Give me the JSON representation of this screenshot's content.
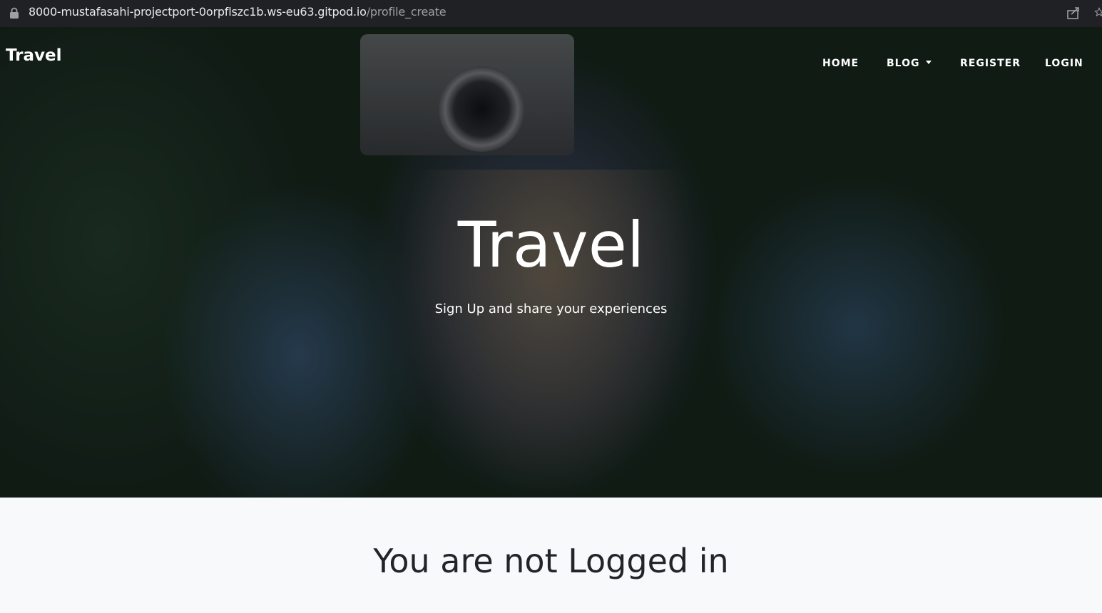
{
  "browser": {
    "url_host": "8000-mustafasahi-projectport-0orpflszc1b.ws-eu63.gitpod.io",
    "url_path": "/profile_create",
    "icons": [
      "lock-icon",
      "share-icon",
      "star-icon"
    ]
  },
  "navbar": {
    "brand": "Travel",
    "items": [
      {
        "label": "HOME"
      },
      {
        "label": "BLOG",
        "dropdown": true
      },
      {
        "label": "REGISTER"
      },
      {
        "label": "LOGIN"
      }
    ]
  },
  "hero": {
    "title": "Travel",
    "subtitle": "Sign Up and share your experiences"
  },
  "main": {
    "message": "You are not Logged in"
  },
  "colors": {
    "browser_bar": "#202124",
    "url_underline": "#e53935",
    "page_background": "#f8f9fa",
    "text_dark": "#212529",
    "text_light": "#ffffff"
  }
}
